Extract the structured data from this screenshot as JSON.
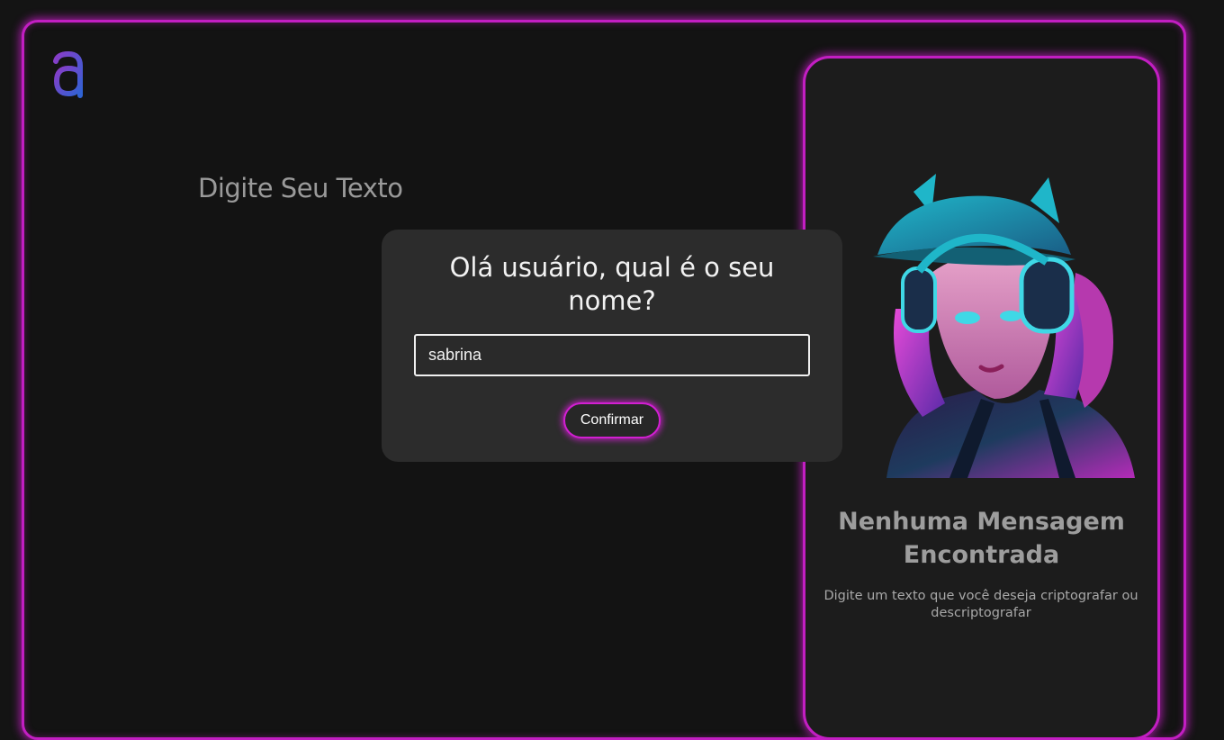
{
  "colors": {
    "background": "#141414",
    "panel": "#1c1c1c",
    "modal": "#2c2c2c",
    "neon_accent": "#c21ec2",
    "logo_gradient_start": "#7a3cc8",
    "logo_gradient_end": "#2f5fd0"
  },
  "header": {
    "logo_icon": "alura-a-logo-icon"
  },
  "main": {
    "input_title": "Digite Seu Texto"
  },
  "modal": {
    "title": "Olá usuário, qual é o seu nome?",
    "name_value": "sabrina",
    "confirm_label": "Confirmar"
  },
  "side_panel": {
    "illustration_icon": "cyberpunk-girl-headphones-illustration",
    "empty_title": "Nenhuma Mensagem Encontrada",
    "empty_text": "Digite um texto que você deseja criptografar ou descriptografar"
  }
}
